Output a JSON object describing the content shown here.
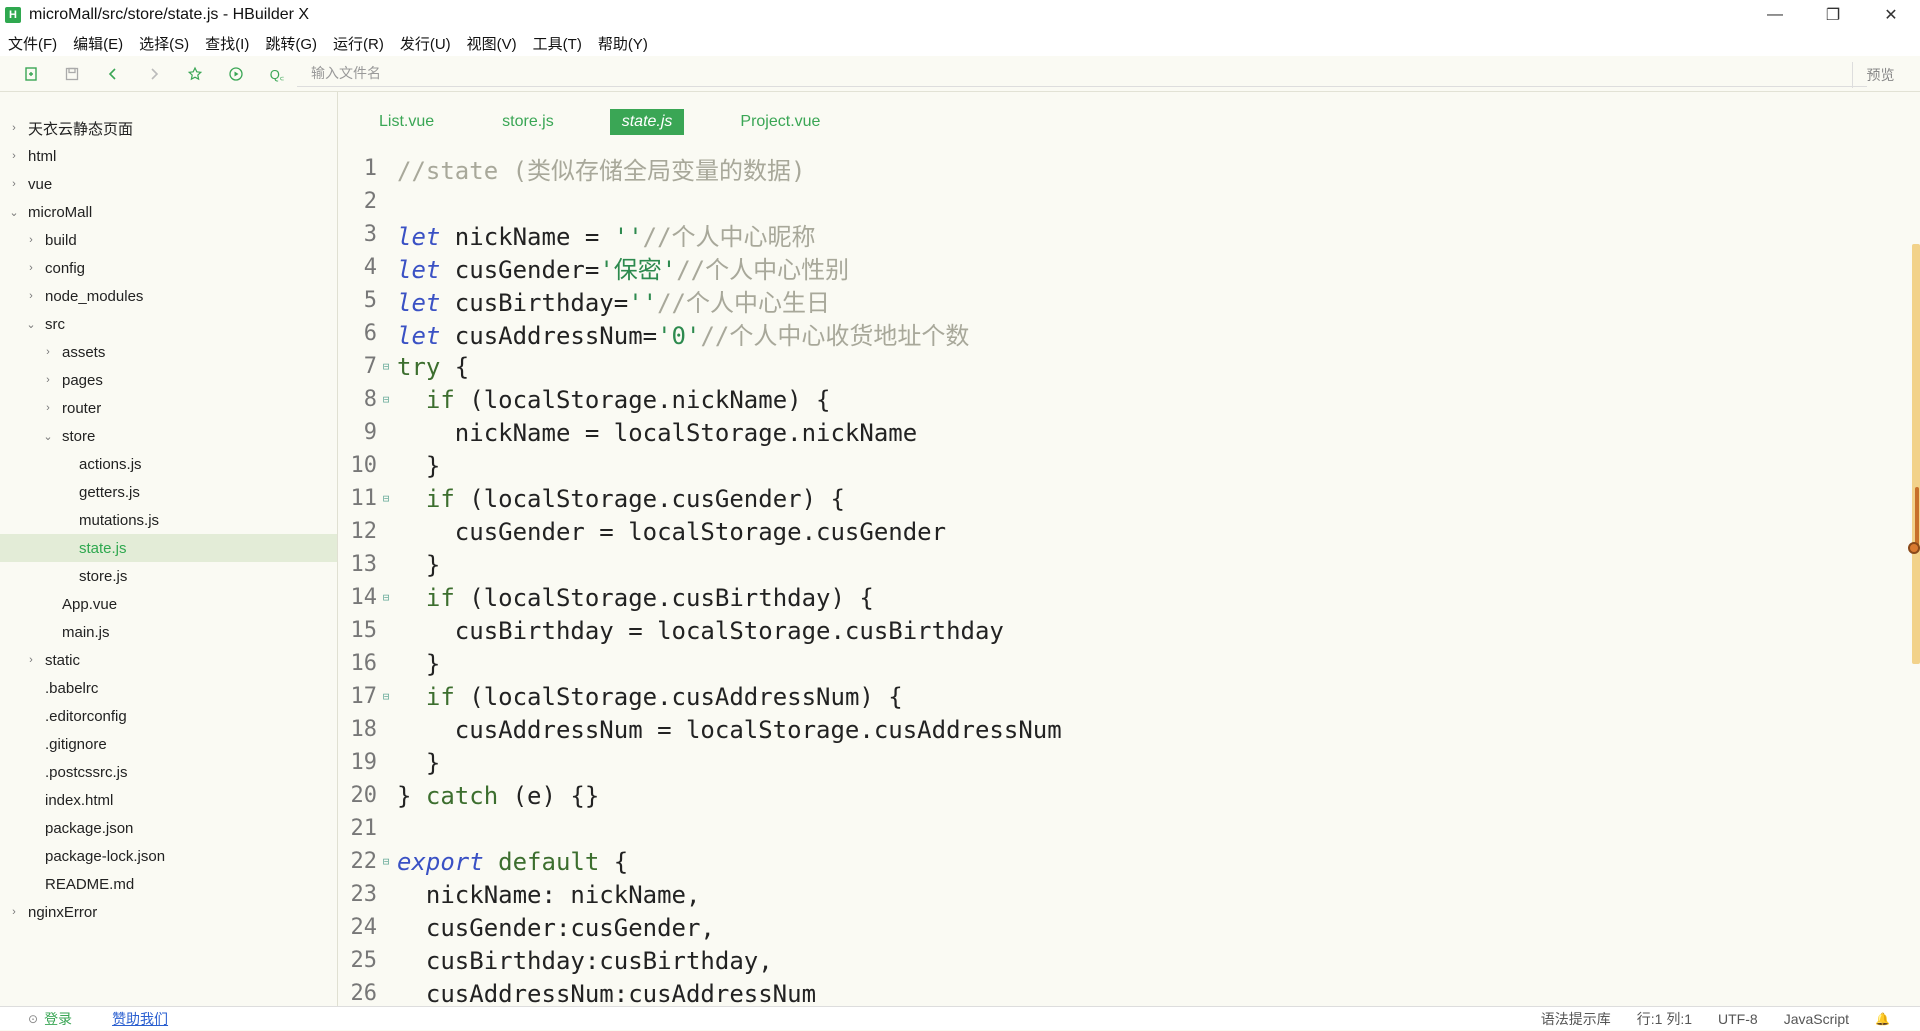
{
  "window": {
    "title": "microMall/src/store/state.js - HBuilder X",
    "logo": "H",
    "controls": {
      "minimize": "—",
      "maximize": "❐",
      "close": "✕"
    }
  },
  "menu": [
    "文件(F)",
    "编辑(E)",
    "选择(S)",
    "查找(I)",
    "跳转(G)",
    "运行(R)",
    "发行(U)",
    "视图(V)",
    "工具(T)",
    "帮助(Y)"
  ],
  "toolbar": {
    "file_search_placeholder": "输入文件名",
    "search_prefix": "Q꜀",
    "preview_label": "预览"
  },
  "tree": [
    {
      "label": "天衣云静态页面",
      "depth": 0,
      "chevron": "›"
    },
    {
      "label": "html",
      "depth": 0,
      "chevron": "›"
    },
    {
      "label": "vue",
      "depth": 0,
      "chevron": "›"
    },
    {
      "label": "microMall",
      "depth": 0,
      "chevron": "⌄"
    },
    {
      "label": "build",
      "depth": 1,
      "chevron": "›"
    },
    {
      "label": "config",
      "depth": 1,
      "chevron": "›"
    },
    {
      "label": "node_modules",
      "depth": 1,
      "chevron": "›"
    },
    {
      "label": "src",
      "depth": 1,
      "chevron": "⌄"
    },
    {
      "label": "assets",
      "depth": 2,
      "chevron": "›"
    },
    {
      "label": "pages",
      "depth": 2,
      "chevron": "›"
    },
    {
      "label": "router",
      "depth": 2,
      "chevron": "›"
    },
    {
      "label": "store",
      "depth": 2,
      "chevron": "⌄"
    },
    {
      "label": "actions.js",
      "depth": 3,
      "chevron": ""
    },
    {
      "label": "getters.js",
      "depth": 3,
      "chevron": ""
    },
    {
      "label": "mutations.js",
      "depth": 3,
      "chevron": ""
    },
    {
      "label": "state.js",
      "depth": 3,
      "chevron": "",
      "selected": true
    },
    {
      "label": "store.js",
      "depth": 3,
      "chevron": ""
    },
    {
      "label": "App.vue",
      "depth": 2,
      "chevron": ""
    },
    {
      "label": "main.js",
      "depth": 2,
      "chevron": ""
    },
    {
      "label": "static",
      "depth": 1,
      "chevron": "›"
    },
    {
      "label": ".babelrc",
      "depth": 1,
      "chevron": ""
    },
    {
      "label": ".editorconfig",
      "depth": 1,
      "chevron": ""
    },
    {
      "label": ".gitignore",
      "depth": 1,
      "chevron": ""
    },
    {
      "label": ".postcssrc.js",
      "depth": 1,
      "chevron": ""
    },
    {
      "label": "index.html",
      "depth": 1,
      "chevron": ""
    },
    {
      "label": "package.json",
      "depth": 1,
      "chevron": ""
    },
    {
      "label": "package-lock.json",
      "depth": 1,
      "chevron": ""
    },
    {
      "label": "README.md",
      "depth": 1,
      "chevron": ""
    },
    {
      "label": "nginxError",
      "depth": 0,
      "chevron": "›"
    }
  ],
  "tabs": [
    {
      "label": "List.vue",
      "active": false
    },
    {
      "label": "store.js",
      "active": false
    },
    {
      "label": "state.js",
      "active": true
    },
    {
      "label": "Project.vue",
      "active": false
    }
  ],
  "code": [
    {
      "n": "1",
      "fold": "",
      "tokens": [
        [
          "cm",
          "//state (类似存储全局变量的数据)"
        ]
      ]
    },
    {
      "n": "2",
      "fold": "",
      "tokens": []
    },
    {
      "n": "3",
      "fold": "",
      "tokens": [
        [
          "kw",
          "let"
        ],
        [
          "",
          " nickName = "
        ],
        [
          "str",
          "''"
        ],
        [
          "cm",
          "//个人中心昵称"
        ]
      ]
    },
    {
      "n": "4",
      "fold": "",
      "tokens": [
        [
          "kw",
          "let"
        ],
        [
          "",
          " cusGender="
        ],
        [
          "str",
          "'保密'"
        ],
        [
          "cm",
          "//个人中心性别"
        ]
      ]
    },
    {
      "n": "5",
      "fold": "",
      "tokens": [
        [
          "kw",
          "let"
        ],
        [
          "",
          " cusBirthday="
        ],
        [
          "str",
          "''"
        ],
        [
          "cm",
          "//个人中心生日"
        ]
      ]
    },
    {
      "n": "6",
      "fold": "",
      "tokens": [
        [
          "kw",
          "let"
        ],
        [
          "",
          " cusAddressNum="
        ],
        [
          "str",
          "'0'"
        ],
        [
          "cm",
          "//个人中心收货地址个数"
        ]
      ]
    },
    {
      "n": "7",
      "fold": "⊟",
      "tokens": [
        [
          "kw2",
          "try"
        ],
        [
          "",
          " {"
        ]
      ]
    },
    {
      "n": "8",
      "fold": "⊟",
      "tokens": [
        [
          "",
          "  "
        ],
        [
          "kw2",
          "if"
        ],
        [
          "",
          " (localStorage.nickName) {"
        ]
      ]
    },
    {
      "n": "9",
      "fold": "",
      "tokens": [
        [
          "",
          "    nickName = localStorage.nickName"
        ]
      ]
    },
    {
      "n": "10",
      "fold": "",
      "tokens": [
        [
          "",
          "  }"
        ]
      ]
    },
    {
      "n": "11",
      "fold": "⊟",
      "tokens": [
        [
          "",
          "  "
        ],
        [
          "kw2",
          "if"
        ],
        [
          "",
          " (localStorage.cusGender) {"
        ]
      ]
    },
    {
      "n": "12",
      "fold": "",
      "tokens": [
        [
          "",
          "    cusGender = localStorage.cusGender"
        ]
      ]
    },
    {
      "n": "13",
      "fold": "",
      "tokens": [
        [
          "",
          "  }"
        ]
      ]
    },
    {
      "n": "14",
      "fold": "⊟",
      "tokens": [
        [
          "",
          "  "
        ],
        [
          "kw2",
          "if"
        ],
        [
          "",
          " (localStorage.cusBirthday) {"
        ]
      ]
    },
    {
      "n": "15",
      "fold": "",
      "tokens": [
        [
          "",
          "    cusBirthday = localStorage.cusBirthday"
        ]
      ]
    },
    {
      "n": "16",
      "fold": "",
      "tokens": [
        [
          "",
          "  }"
        ]
      ]
    },
    {
      "n": "17",
      "fold": "⊟",
      "tokens": [
        [
          "",
          "  "
        ],
        [
          "kw2",
          "if"
        ],
        [
          "",
          " (localStorage.cusAddressNum) {"
        ]
      ]
    },
    {
      "n": "18",
      "fold": "",
      "tokens": [
        [
          "",
          "    cusAddressNum = localStorage.cusAddressNum"
        ]
      ]
    },
    {
      "n": "19",
      "fold": "",
      "tokens": [
        [
          "",
          "  }"
        ]
      ]
    },
    {
      "n": "20",
      "fold": "",
      "tokens": [
        [
          "",
          "} "
        ],
        [
          "kw2",
          "catch"
        ],
        [
          "",
          " (e) {}"
        ]
      ]
    },
    {
      "n": "21",
      "fold": "",
      "tokens": []
    },
    {
      "n": "22",
      "fold": "⊟",
      "tokens": [
        [
          "kw",
          "export"
        ],
        [
          "",
          " "
        ],
        [
          "kw2",
          "default"
        ],
        [
          "",
          " {"
        ]
      ]
    },
    {
      "n": "23",
      "fold": "",
      "tokens": [
        [
          "",
          "  nickName: nickName,"
        ]
      ]
    },
    {
      "n": "24",
      "fold": "",
      "tokens": [
        [
          "",
          "  cusGender:cusGender,"
        ]
      ]
    },
    {
      "n": "25",
      "fold": "",
      "tokens": [
        [
          "",
          "  cusBirthday:cusBirthday,"
        ]
      ]
    },
    {
      "n": "26",
      "fold": "",
      "tokens": [
        [
          "",
          "  cusAddressNum:cusAddressNum"
        ]
      ]
    }
  ],
  "status": {
    "login_label": "登录",
    "sponsor_label": "赞助我们",
    "syntax_lib": "语法提示库",
    "position": "行:1  列:1",
    "encoding": "UTF-8",
    "language": "JavaScript"
  },
  "colors": {
    "accent": "#3aa655",
    "keyword": "#3a51c4",
    "comment": "#a8a89a",
    "string": "#2d8a4e"
  }
}
